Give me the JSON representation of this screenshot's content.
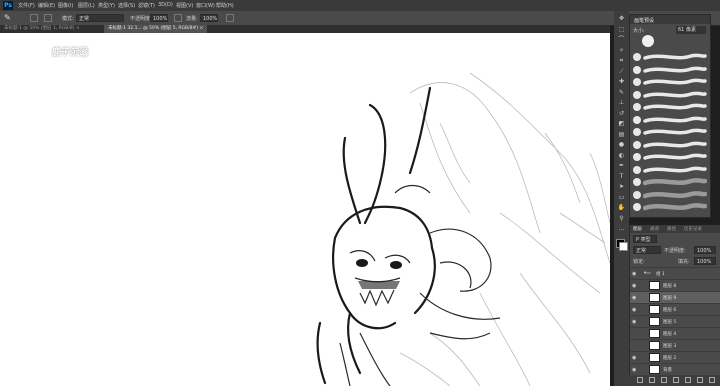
{
  "app": {
    "logo": "Ps"
  },
  "menubar": {
    "items": [
      {
        "label": "文件(F)"
      },
      {
        "label": "编辑(E)"
      },
      {
        "label": "图像(I)"
      },
      {
        "label": "图层(L)"
      },
      {
        "label": "类型(Y)"
      },
      {
        "label": "选择(S)"
      },
      {
        "label": "滤镜(T)"
      },
      {
        "label": "3D(D)"
      },
      {
        "label": "视图(V)"
      },
      {
        "label": "窗口(W)"
      },
      {
        "label": "帮助(H)"
      }
    ]
  },
  "options": {
    "mode_label": "模式:",
    "mode_value": "正常",
    "opacity_label": "不透明度:",
    "opacity_value": "100%",
    "flow_label": "流量:",
    "flow_value": "100%"
  },
  "tabs": [
    {
      "label": "未标题-1 @ 50% (图层 1, RGB/8) ×"
    },
    {
      "label": "未标题-1 32.1... @ 50% (图层 5, RGB/8#) ×"
    }
  ],
  "watermark": {
    "text": "鹿子沉溺"
  },
  "toolbar": {
    "tools": [
      {
        "name": "move-tool-icon",
        "glyph": "✥"
      },
      {
        "name": "marquee-tool-icon",
        "glyph": "⬚"
      },
      {
        "name": "lasso-tool-icon",
        "glyph": "⌒"
      },
      {
        "name": "quick-select-tool-icon",
        "glyph": "✧"
      },
      {
        "name": "crop-tool-icon",
        "glyph": "⌗"
      },
      {
        "name": "eyedropper-tool-icon",
        "glyph": "⟋"
      },
      {
        "name": "healing-brush-tool-icon",
        "glyph": "✚"
      },
      {
        "name": "brush-tool-icon",
        "glyph": "✎"
      },
      {
        "name": "clone-stamp-tool-icon",
        "glyph": "⊥"
      },
      {
        "name": "history-brush-tool-icon",
        "glyph": "↺"
      },
      {
        "name": "eraser-tool-icon",
        "glyph": "◩"
      },
      {
        "name": "gradient-tool-icon",
        "glyph": "▤"
      },
      {
        "name": "blur-tool-icon",
        "glyph": "●"
      },
      {
        "name": "dodge-tool-icon",
        "glyph": "◐"
      },
      {
        "name": "pen-tool-icon",
        "glyph": "✒"
      },
      {
        "name": "type-tool-icon",
        "glyph": "T"
      },
      {
        "name": "path-select-tool-icon",
        "glyph": "➤"
      },
      {
        "name": "shape-tool-icon",
        "glyph": "▭"
      },
      {
        "name": "hand-tool-icon",
        "glyph": "✋"
      },
      {
        "name": "zoom-tool-icon",
        "glyph": "⚲"
      },
      {
        "name": "more-tools-icon",
        "glyph": "…"
      }
    ],
    "fg_color": "#000000",
    "bg_color": "#ffffff"
  },
  "brush_panel": {
    "title": "画笔预设",
    "size_label": "大小:",
    "size_value": "61 像素",
    "preset_count": 13
  },
  "layers_panel": {
    "tabs": [
      "图层",
      "通道",
      "路径",
      "历史记录"
    ],
    "kind_label": "P 类型",
    "blend_mode": "正常",
    "opacity_label": "不透明度:",
    "opacity_value": "100%",
    "lock_label": "锁定:",
    "fill_label": "填充:",
    "fill_value": "100%",
    "layers": [
      {
        "name": "组 1",
        "visible": true,
        "group": true
      },
      {
        "name": "图层 8",
        "visible": true,
        "group": false
      },
      {
        "name": "图层 9",
        "visible": true,
        "group": false
      },
      {
        "name": "图层 6",
        "visible": true,
        "group": false
      },
      {
        "name": "图层 5",
        "visible": true,
        "group": false
      },
      {
        "name": "图层 4",
        "visible": false,
        "group": false
      },
      {
        "name": "图层 3",
        "visible": false,
        "group": false
      },
      {
        "name": "图层 2",
        "visible": true,
        "group": false
      },
      {
        "name": "背景",
        "visible": true,
        "group": false
      }
    ]
  },
  "colors": {
    "menubar_bg": "#3a3a3a",
    "panel_bg": "#4a4a4a",
    "canvas_bg": "#ffffff",
    "selected_layer": "#5f5f5f"
  }
}
